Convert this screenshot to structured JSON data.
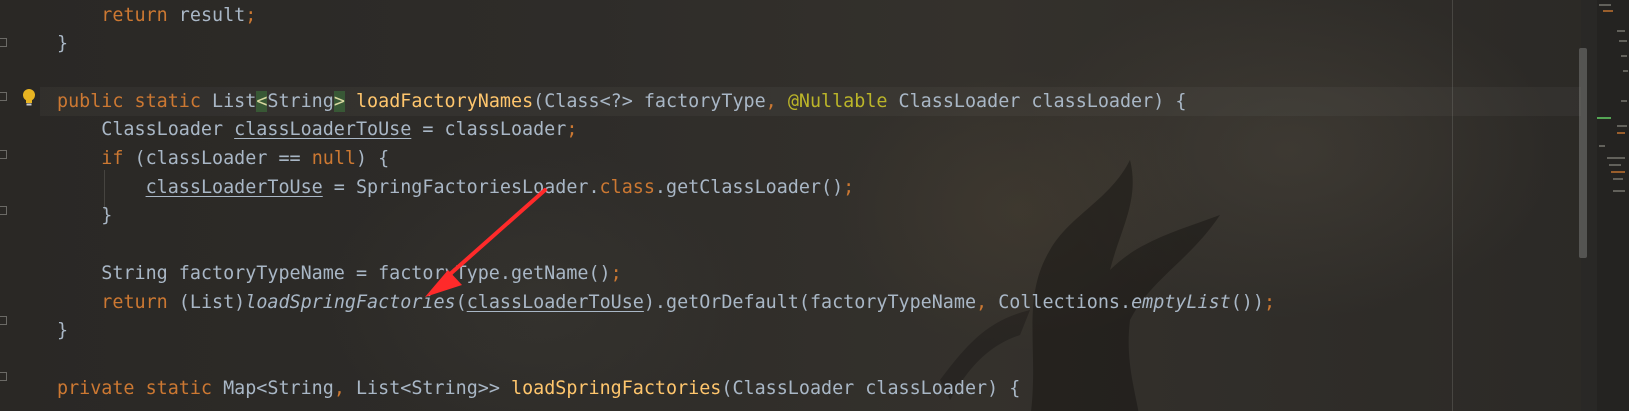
{
  "code_lines": [
    {
      "id": "l0",
      "tokens": [
        {
          "t": "    "
        },
        {
          "t": "return",
          "c": "kw"
        },
        {
          "t": " result"
        },
        {
          "t": ";",
          "c": "kw"
        }
      ]
    },
    {
      "id": "l1",
      "tokens": [
        {
          "t": "}"
        }
      ]
    },
    {
      "id": "l2",
      "tokens": [
        {
          "t": ""
        }
      ]
    },
    {
      "id": "l3",
      "tokens": [
        {
          "t": "public static ",
          "c": "kw"
        },
        {
          "t": "List"
        },
        {
          "t": "<",
          "c": "bg"
        },
        {
          "t": "String"
        },
        {
          "t": ">",
          "c": "bg"
        },
        {
          "t": " "
        },
        {
          "t": "loadFactoryNames",
          "c": "fn"
        },
        {
          "t": "(Class<?> factoryType"
        },
        {
          "t": ", ",
          "c": "kw"
        },
        {
          "t": "@Nullable",
          "c": "an"
        },
        {
          "t": " ClassLoader classLoader) {"
        }
      ]
    },
    {
      "id": "l4",
      "tokens": [
        {
          "t": "    ClassLoader "
        },
        {
          "t": "classLoaderToUse",
          "c": "ul"
        },
        {
          "t": " = classLoader"
        },
        {
          "t": ";",
          "c": "kw"
        }
      ]
    },
    {
      "id": "l5",
      "tokens": [
        {
          "t": "    "
        },
        {
          "t": "if",
          "c": "kw"
        },
        {
          "t": " (classLoader == "
        },
        {
          "t": "null",
          "c": "kw"
        },
        {
          "t": ") {"
        }
      ]
    },
    {
      "id": "l6",
      "tokens": [
        {
          "t": "        "
        },
        {
          "t": "classLoaderToUse",
          "c": "ul"
        },
        {
          "t": " = SpringFactoriesLoader."
        },
        {
          "t": "class",
          "c": "kw"
        },
        {
          "t": ".getClassLoader()"
        },
        {
          "t": ";",
          "c": "kw"
        }
      ]
    },
    {
      "id": "l7",
      "tokens": [
        {
          "t": "    }"
        }
      ]
    },
    {
      "id": "l8",
      "tokens": [
        {
          "t": ""
        }
      ]
    },
    {
      "id": "l9",
      "tokens": [
        {
          "t": "    String factoryTypeName = factoryType.getName()"
        },
        {
          "t": ";",
          "c": "kw"
        }
      ]
    },
    {
      "id": "l10",
      "tokens": [
        {
          "t": "    "
        },
        {
          "t": "return",
          "c": "kw"
        },
        {
          "t": " (List)"
        },
        {
          "t": "loadSpringFactories",
          "c": "it"
        },
        {
          "t": "("
        },
        {
          "t": "classLoaderToUse",
          "c": "ul"
        },
        {
          "t": ").getOrDefault(factoryTypeName"
        },
        {
          "t": ", ",
          "c": "kw"
        },
        {
          "t": "Collections."
        },
        {
          "t": "emptyList",
          "c": "it"
        },
        {
          "t": "())"
        },
        {
          "t": ";",
          "c": "kw"
        }
      ]
    },
    {
      "id": "l11",
      "tokens": [
        {
          "t": "}"
        }
      ]
    },
    {
      "id": "l12",
      "tokens": [
        {
          "t": ""
        }
      ]
    },
    {
      "id": "l13",
      "tokens": [
        {
          "t": "private static ",
          "c": "kw"
        },
        {
          "t": "Map<String"
        },
        {
          "t": ", ",
          "c": "kw"
        },
        {
          "t": "List<String>> "
        },
        {
          "t": "loadSpringFactories",
          "c": "fn"
        },
        {
          "t": "(ClassLoader classLoader) {"
        }
      ]
    }
  ],
  "icons": {
    "bulb": "lightbulb-icon",
    "arrow": "red-arrow-annotation"
  },
  "colors": {
    "keyword": "#cc7832",
    "function": "#ffc66d",
    "annotation": "#bbb529",
    "text": "#a9b7c6",
    "arrow": "#ff2a2a"
  }
}
